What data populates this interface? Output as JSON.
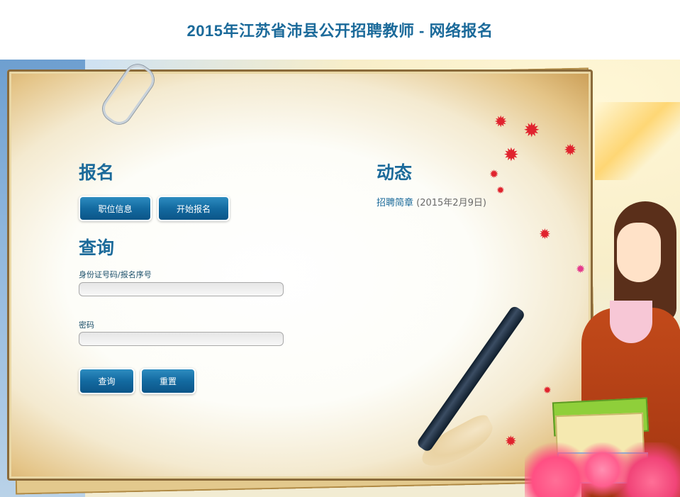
{
  "page_title": "2015年江苏省沛县公开招聘教师 - 网络报名",
  "register": {
    "title": "报名",
    "job_info_label": "职位信息",
    "start_label": "开始报名"
  },
  "query": {
    "title": "查询",
    "id_label": "身份证号码/报名序号",
    "id_value": "",
    "password_label": "密码",
    "password_value": "",
    "submit_label": "查询",
    "reset_label": "重置"
  },
  "news": {
    "title": "动态",
    "items": [
      {
        "title": "招聘简章",
        "date": "(2015年2月9日)"
      }
    ]
  },
  "colors": {
    "accent": "#1b6a9a",
    "button_top": "#2d8cc0",
    "button_bottom": "#0c5588"
  },
  "icons": [
    "paperclip-icon",
    "maple-leaf-icon",
    "brush-icon"
  ]
}
